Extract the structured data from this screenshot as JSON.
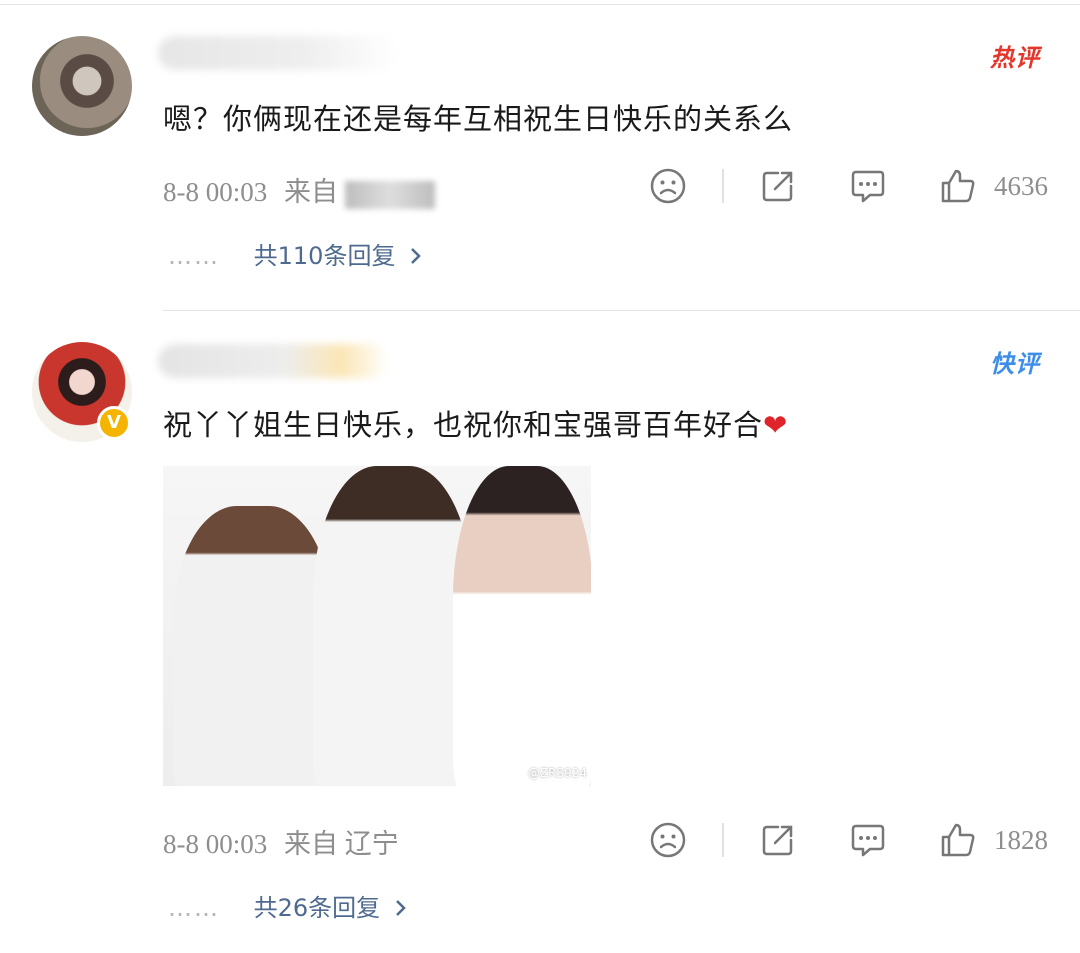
{
  "comments": [
    {
      "badge": "热评",
      "text": "嗯？你俩现在还是每年互相祝生日快乐的关系么",
      "time": "8-8 00:03",
      "location_prefix": "来自",
      "location": "",
      "likes": "4636",
      "replies": {
        "dots": "……",
        "label": "共110条回复"
      }
    },
    {
      "badge": "快评",
      "text": "祝丫丫姐生日快乐，也祝你和宝强哥百年好合",
      "emoji": "❤",
      "time": "8-8 00:03",
      "location_prefix": "来自",
      "location": "辽宁",
      "likes": "1828",
      "replies": {
        "dots": "……",
        "label": "共26条回复"
      },
      "image_watermark": "@ZRS924"
    }
  ],
  "colors": {
    "hot": "#e5362b",
    "fast": "#3d8ee8",
    "link": "#4f6a8f",
    "meta": "#8e8e8e"
  },
  "icons": [
    "sad-face-icon",
    "share-icon",
    "comment-icon",
    "thumbs-up-icon",
    "chevron-right-icon",
    "verified-icon"
  ]
}
